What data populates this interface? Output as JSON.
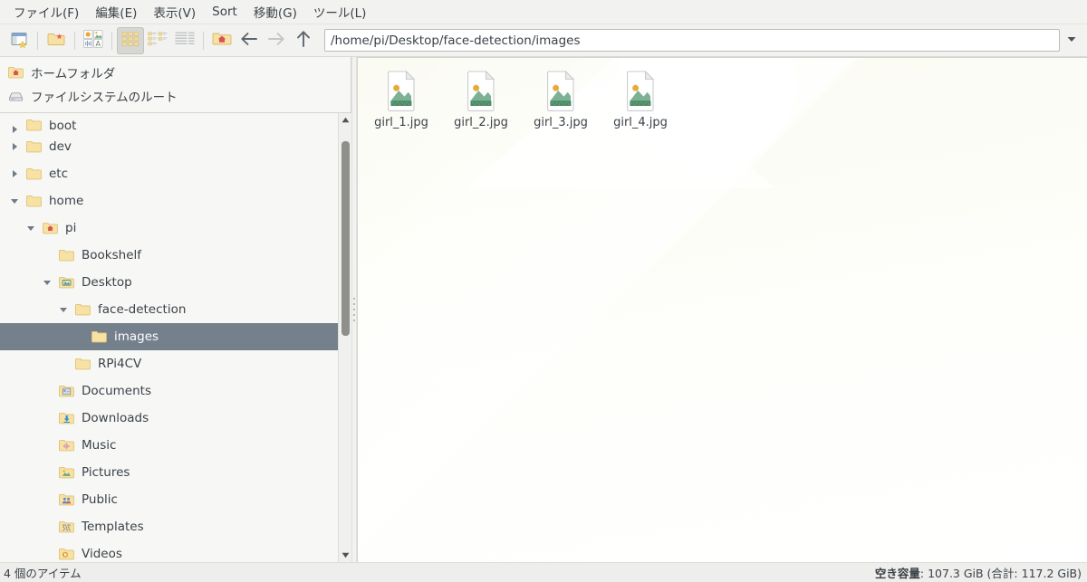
{
  "menubar": {
    "items": [
      {
        "label": "ファイル(F)",
        "name": "menu-file"
      },
      {
        "label": "編集(E)",
        "name": "menu-edit"
      },
      {
        "label": "表示(V)",
        "name": "menu-view"
      },
      {
        "label": "Sort",
        "name": "menu-sort"
      },
      {
        "label": "移動(G)",
        "name": "menu-go"
      },
      {
        "label": "ツール(L)",
        "name": "menu-tools"
      }
    ]
  },
  "toolbar": {
    "buttons": [
      {
        "icon": "new-window-icon",
        "name": "new-window-button"
      },
      {
        "icon": "new-folder-icon",
        "name": "new-folder-button"
      },
      {
        "icon": "view-options-icon",
        "name": "view-options-button"
      },
      {
        "icon": "icon-view-icon",
        "name": "icon-view-button"
      },
      {
        "icon": "compact-view-icon",
        "name": "compact-view-button"
      },
      {
        "icon": "detailed-list-view-icon",
        "name": "detailed-list-view-button"
      },
      {
        "icon": "home-folder-icon",
        "name": "home-button"
      },
      {
        "icon": "arrow-left-icon",
        "name": "back-button"
      },
      {
        "icon": "arrow-right-icon",
        "name": "forward-button"
      },
      {
        "icon": "arrow-up-icon",
        "name": "up-button"
      }
    ],
    "path": "/home/pi/Desktop/face-detection/images",
    "path_placeholder": "",
    "dropdown_icon": "chevron-down-icon"
  },
  "sidebar": {
    "places": [
      {
        "label": "ホームフォルダ",
        "icon": "home-folder-icon",
        "name": "place-home-folder"
      },
      {
        "label": "ファイルシステムのルート",
        "icon": "drive-icon",
        "name": "place-filesystem-root"
      }
    ],
    "tree": [
      {
        "label": "boot",
        "indent": 0,
        "twist": "closed",
        "icon": "folder-icon",
        "selected": false,
        "partial": true
      },
      {
        "label": "dev",
        "indent": 0,
        "twist": "closed",
        "icon": "folder-icon",
        "selected": false
      },
      {
        "label": "etc",
        "indent": 0,
        "twist": "closed",
        "icon": "folder-icon",
        "selected": false
      },
      {
        "label": "home",
        "indent": 0,
        "twist": "open",
        "icon": "folder-icon",
        "selected": false
      },
      {
        "label": "pi",
        "indent": 1,
        "twist": "open",
        "icon": "home-folder-icon",
        "selected": false
      },
      {
        "label": "Bookshelf",
        "indent": 2,
        "twist": "none",
        "icon": "folder-icon",
        "selected": false
      },
      {
        "label": "Desktop",
        "indent": 2,
        "twist": "open",
        "icon": "desktop-folder-icon",
        "selected": false
      },
      {
        "label": "face-detection",
        "indent": 3,
        "twist": "open",
        "icon": "folder-icon",
        "selected": false
      },
      {
        "label": "images",
        "indent": 4,
        "twist": "none",
        "icon": "folder-icon",
        "selected": true
      },
      {
        "label": "RPi4CV",
        "indent": 3,
        "twist": "none",
        "icon": "folder-icon",
        "selected": false
      },
      {
        "label": "Documents",
        "indent": 2,
        "twist": "none",
        "icon": "documents-folder-icon",
        "selected": false
      },
      {
        "label": "Downloads",
        "indent": 2,
        "twist": "none",
        "icon": "downloads-folder-icon",
        "selected": false
      },
      {
        "label": "Music",
        "indent": 2,
        "twist": "none",
        "icon": "music-folder-icon",
        "selected": false
      },
      {
        "label": "Pictures",
        "indent": 2,
        "twist": "none",
        "icon": "pictures-folder-icon",
        "selected": false
      },
      {
        "label": "Public",
        "indent": 2,
        "twist": "none",
        "icon": "public-folder-icon",
        "selected": false
      },
      {
        "label": "Templates",
        "indent": 2,
        "twist": "none",
        "icon": "templates-folder-icon",
        "selected": false
      },
      {
        "label": "Videos",
        "indent": 2,
        "twist": "none",
        "icon": "videos-folder-icon",
        "selected": false
      }
    ],
    "scrollbar": {
      "up_icon": "scroll-up-arrow-icon",
      "down_icon": "scroll-down-arrow-icon"
    }
  },
  "files": [
    {
      "name": "girl_1.jpg",
      "icon": "image-file-icon"
    },
    {
      "name": "girl_2.jpg",
      "icon": "image-file-icon"
    },
    {
      "name": "girl_3.jpg",
      "icon": "image-file-icon"
    },
    {
      "name": "girl_4.jpg",
      "icon": "image-file-icon"
    }
  ],
  "statusbar": {
    "left": "4 個のアイテム",
    "free_label": "空き容量",
    "free_value": ": 107.3 GiB (合計: 117.2 GiB)"
  },
  "colors": {
    "selection": "#74808c",
    "toolbar_bg": "#f2f2f0",
    "sidebar_bg": "#f7f7f5",
    "pane_bg": "#fdfdf8",
    "folder_yellow": "#f2d98f",
    "text": "#3b4248"
  }
}
